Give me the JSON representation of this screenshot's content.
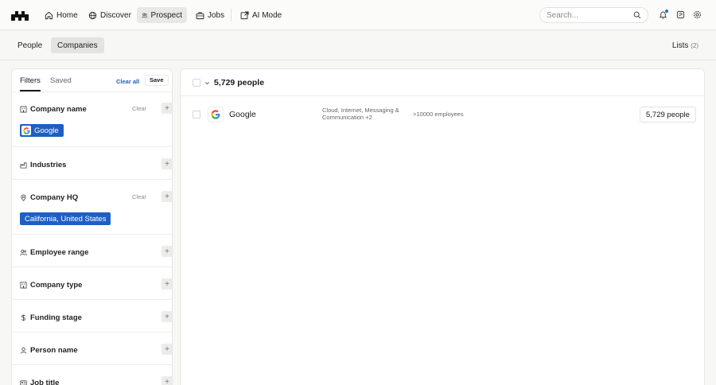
{
  "nav": {
    "items": [
      {
        "label": "Home",
        "icon": "home-icon"
      },
      {
        "label": "Discover",
        "icon": "globe-icon"
      },
      {
        "label": "Prospect",
        "icon": "users-icon"
      },
      {
        "label": "Jobs",
        "icon": "briefcase-icon"
      },
      {
        "label": "AI Mode",
        "icon": "ai-icon"
      }
    ],
    "active": "Prospect",
    "search_placeholder": "Search..."
  },
  "subnav": {
    "tabs": [
      "People",
      "Companies"
    ],
    "active": "Companies",
    "lists_label": "Lists",
    "lists_count": "(2)"
  },
  "filters": {
    "tabs": [
      "Filters",
      "Saved"
    ],
    "clear_all": "Clear all",
    "save": "Save",
    "clear": "Clear",
    "sections": [
      {
        "label": "Company name",
        "icon": "building-icon",
        "chip": "Google"
      },
      {
        "label": "Industries",
        "icon": "factory-icon"
      },
      {
        "label": "Company HQ",
        "icon": "location-pin-icon",
        "chip": "California, United States"
      },
      {
        "label": "Employee range",
        "icon": "users-icon"
      },
      {
        "label": "Company type",
        "icon": "building-icon"
      },
      {
        "label": "Funding stage",
        "icon": "dollar-icon"
      },
      {
        "label": "Person name",
        "icon": "person-icon"
      },
      {
        "label": "Job title",
        "icon": "id-card-icon"
      }
    ]
  },
  "results": {
    "title": "5,729 people",
    "rows": [
      {
        "name": "Google",
        "industries": "Cloud, Internet, Messaging & Communication +2",
        "size": ">10000 employees",
        "people": "5,729 people"
      }
    ]
  },
  "colors": {
    "accent": "#1f5fc4",
    "background": "#f7f7f6"
  }
}
